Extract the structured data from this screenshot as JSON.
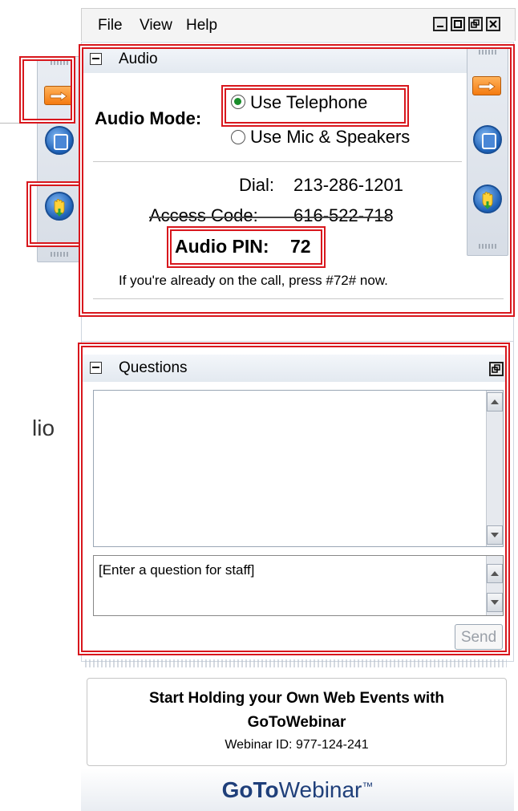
{
  "menu": {
    "file": "File",
    "view": "View",
    "help": "Help"
  },
  "window_buttons": [
    "minimize-icon",
    "maximize-icon",
    "restore-icon",
    "close-icon"
  ],
  "audio": {
    "header": "Audio",
    "mode_label": "Audio Mode:",
    "option_telephone": "Use Telephone",
    "option_mic": "Use Mic & Speakers",
    "selected": "Use Telephone",
    "dial_label": "Dial:",
    "dial_value": "213-286-1201",
    "access_label": "Access Code:",
    "access_value": "616-522-718",
    "pin_label": "Audio PIN:",
    "pin_value": "72",
    "note": "If you're already on the call, press #72# now."
  },
  "questions": {
    "header": "Questions",
    "input_placeholder": "[Enter a question for staff]",
    "send_label": "Send"
  },
  "promo": {
    "line1": "Start Holding your Own Web Events with",
    "line2": "GoToWebinar",
    "webinar_id": "Webinar ID: 977-124-241"
  },
  "logo": {
    "go": "GoTo",
    "webinar": "Webinar",
    "tm": "™"
  },
  "background_fragments": {
    "right_edge_colon": ":",
    "audio_suffix": "lio"
  },
  "colors": {
    "highlight_red": "#d8171d",
    "radio_selected": "#1a8d2b",
    "arrow_orange": "#f47a10",
    "button_blue": "#1c5fb5"
  }
}
